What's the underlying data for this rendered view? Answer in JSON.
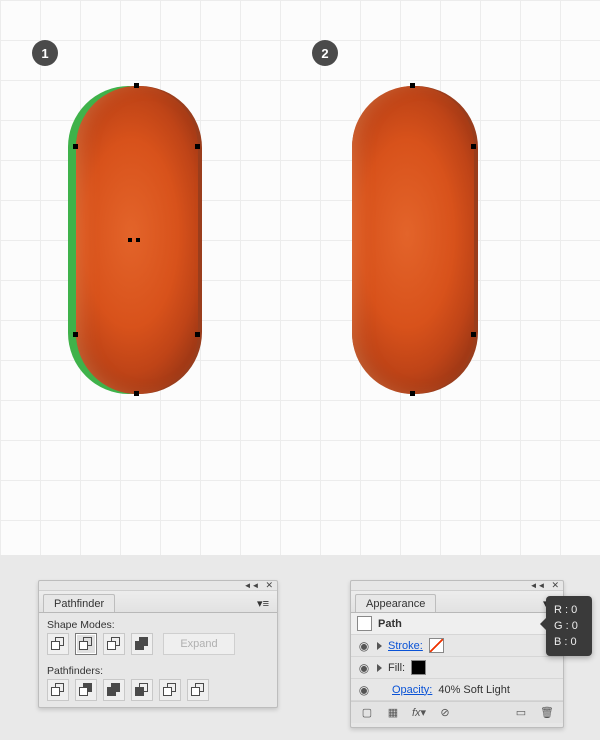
{
  "badges": {
    "one": "1",
    "two": "2"
  },
  "pathfinder": {
    "title": "Pathfinder",
    "shape_modes_label": "Shape Modes:",
    "pathfinders_label": "Pathfinders:",
    "expand_label": "Expand",
    "shape_mode_buttons": [
      "unite",
      "minus-front",
      "intersect",
      "exclude"
    ],
    "pathfinder_buttons": [
      "divide",
      "trim",
      "merge",
      "crop",
      "outline",
      "minus-back"
    ],
    "active_shape_mode": "minus-front"
  },
  "appearance": {
    "title": "Appearance",
    "object_label": "Path",
    "rows": {
      "stroke_label": "Stroke:",
      "fill_label": "Fill:",
      "opacity_label": "Opacity:",
      "opacity_value": "40% Soft Light"
    }
  },
  "rgb": {
    "r": "R : 0",
    "g": "G : 0",
    "b": "B : 0"
  },
  "colors": {
    "pill_green": "#3fb24a",
    "pill_orange": "#d8521b",
    "pill_orange_dark": "#9a3d1c"
  }
}
